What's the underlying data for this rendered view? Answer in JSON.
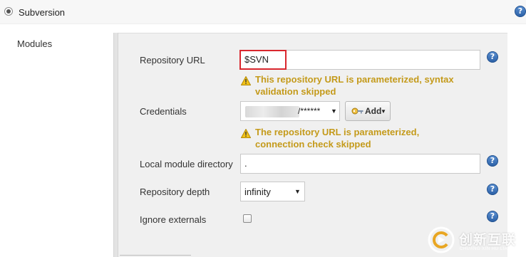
{
  "scm": {
    "option_label": "Subversion"
  },
  "modules": {
    "section_label": "Modules",
    "repository_url": {
      "label": "Repository URL",
      "value": "$SVN",
      "warning": "This repository URL is parameterized, syntax validation skipped"
    },
    "credentials": {
      "label": "Credentials",
      "selected_value": "/******",
      "add_button_label": "Add",
      "warning": "The repository URL is parameterized, connection check skipped"
    },
    "local_module_directory": {
      "label": "Local module directory",
      "value": "."
    },
    "repository_depth": {
      "label": "Repository depth",
      "selected_value": "infinity"
    },
    "ignore_externals": {
      "label": "Ignore externals",
      "checked": false
    }
  },
  "icons": {
    "help": "help-icon",
    "warning": "warning-icon",
    "key": "key-icon",
    "dropdown": "chevron-down-icon"
  },
  "colors": {
    "warning_text": "#c49a1a",
    "highlight_border": "#d9272e",
    "help_icon": "#2d62a8",
    "panel_bg": "#f0f0f0"
  },
  "watermark": {
    "text": "创新互联",
    "sub": "CHUANG XIN HU LIAN"
  }
}
